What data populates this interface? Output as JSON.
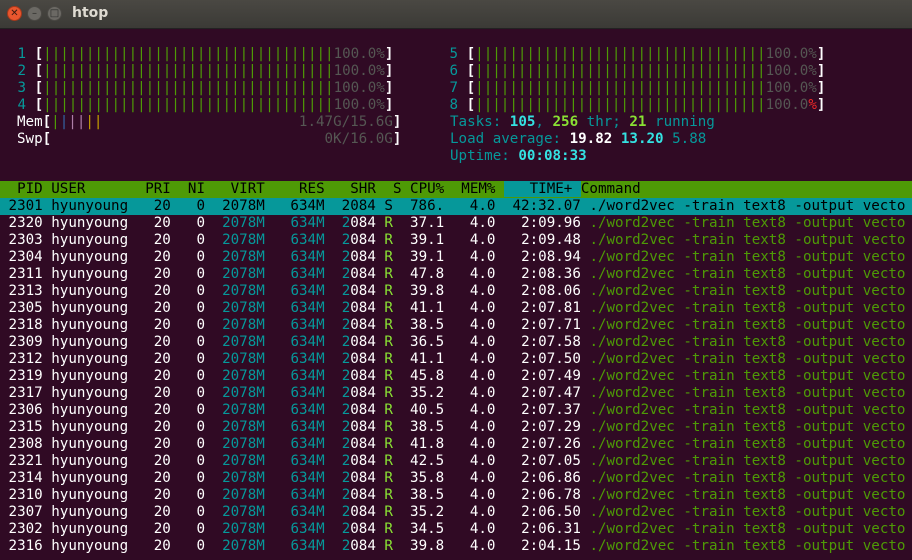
{
  "window": {
    "title": "htop"
  },
  "cpus_left": [
    {
      "id": "1",
      "bar": "||||||||||||||||||||||||||||||||||",
      "pct": "100.0%"
    },
    {
      "id": "2",
      "bar": "||||||||||||||||||||||||||||||||||",
      "pct": "100.0%"
    },
    {
      "id": "3",
      "bar": "||||||||||||||||||||||||||||||||||",
      "pct": "100.0%"
    },
    {
      "id": "4",
      "bar": "||||||||||||||||||||||||||||||||||",
      "pct": "100.0%"
    }
  ],
  "cpus_right": [
    {
      "id": "5",
      "bar": "||||||||||||||||||||||||||||||||||",
      "pct": "100.0%"
    },
    {
      "id": "6",
      "bar": "||||||||||||||||||||||||||||||||||",
      "pct": "100.0%"
    },
    {
      "id": "7",
      "bar": "||||||||||||||||||||||||||||||||||",
      "pct": "100.0%"
    },
    {
      "id": "8",
      "bar": "||||||||||||||||||||||||||||||||||",
      "pct": "100.0"
    }
  ],
  "mem": {
    "label": "Mem",
    "bars": [
      "|",
      "|",
      "|",
      "|",
      "|",
      "|"
    ],
    "value": "1.47G/15.6G"
  },
  "swp": {
    "label": "Swp",
    "value": "0K/16.0G"
  },
  "tasks": {
    "label": "Tasks: ",
    "count": "105",
    "thr": "256",
    "thr_label": " thr; ",
    "running": "21",
    "running_label": " running"
  },
  "load": {
    "label": "Load average: ",
    "l1": "19.82",
    "l5": "13.20",
    "l15": "5.88"
  },
  "uptime": {
    "label": "Uptime: ",
    "value": "00:08:33"
  },
  "columns": [
    "PID",
    "USER",
    "PRI",
    "NI",
    "VIRT",
    "RES",
    "SHR",
    "S",
    "CPU%",
    "MEM%",
    "TIME+",
    "Command"
  ],
  "processes": [
    {
      "pid": "2301",
      "user": "hyunyoung",
      "pri": "20",
      "ni": "0",
      "virt": "2078M",
      "res": "634M",
      "shr": "2084",
      "s": "S",
      "cpu": "786.",
      "mem": "4.0",
      "time": "42:32.07",
      "cmd": "./word2vec -train text8 -output vecto"
    },
    {
      "pid": "2320",
      "user": "hyunyoung",
      "pri": "20",
      "ni": "0",
      "virt": "2078M",
      "res": "634M",
      "shr": "2084",
      "s": "R",
      "cpu": "37.1",
      "mem": "4.0",
      "time": "2:09.96",
      "cmd": "./word2vec -train text8 -output vecto"
    },
    {
      "pid": "2303",
      "user": "hyunyoung",
      "pri": "20",
      "ni": "0",
      "virt": "2078M",
      "res": "634M",
      "shr": "2084",
      "s": "R",
      "cpu": "39.1",
      "mem": "4.0",
      "time": "2:09.48",
      "cmd": "./word2vec -train text8 -output vecto"
    },
    {
      "pid": "2304",
      "user": "hyunyoung",
      "pri": "20",
      "ni": "0",
      "virt": "2078M",
      "res": "634M",
      "shr": "2084",
      "s": "R",
      "cpu": "39.1",
      "mem": "4.0",
      "time": "2:08.94",
      "cmd": "./word2vec -train text8 -output vecto"
    },
    {
      "pid": "2311",
      "user": "hyunyoung",
      "pri": "20",
      "ni": "0",
      "virt": "2078M",
      "res": "634M",
      "shr": "2084",
      "s": "R",
      "cpu": "47.8",
      "mem": "4.0",
      "time": "2:08.36",
      "cmd": "./word2vec -train text8 -output vecto"
    },
    {
      "pid": "2313",
      "user": "hyunyoung",
      "pri": "20",
      "ni": "0",
      "virt": "2078M",
      "res": "634M",
      "shr": "2084",
      "s": "R",
      "cpu": "39.8",
      "mem": "4.0",
      "time": "2:08.06",
      "cmd": "./word2vec -train text8 -output vecto"
    },
    {
      "pid": "2305",
      "user": "hyunyoung",
      "pri": "20",
      "ni": "0",
      "virt": "2078M",
      "res": "634M",
      "shr": "2084",
      "s": "R",
      "cpu": "41.1",
      "mem": "4.0",
      "time": "2:07.81",
      "cmd": "./word2vec -train text8 -output vecto"
    },
    {
      "pid": "2318",
      "user": "hyunyoung",
      "pri": "20",
      "ni": "0",
      "virt": "2078M",
      "res": "634M",
      "shr": "2084",
      "s": "R",
      "cpu": "38.5",
      "mem": "4.0",
      "time": "2:07.71",
      "cmd": "./word2vec -train text8 -output vecto"
    },
    {
      "pid": "2309",
      "user": "hyunyoung",
      "pri": "20",
      "ni": "0",
      "virt": "2078M",
      "res": "634M",
      "shr": "2084",
      "s": "R",
      "cpu": "36.5",
      "mem": "4.0",
      "time": "2:07.58",
      "cmd": "./word2vec -train text8 -output vecto"
    },
    {
      "pid": "2312",
      "user": "hyunyoung",
      "pri": "20",
      "ni": "0",
      "virt": "2078M",
      "res": "634M",
      "shr": "2084",
      "s": "R",
      "cpu": "41.1",
      "mem": "4.0",
      "time": "2:07.50",
      "cmd": "./word2vec -train text8 -output vecto"
    },
    {
      "pid": "2319",
      "user": "hyunyoung",
      "pri": "20",
      "ni": "0",
      "virt": "2078M",
      "res": "634M",
      "shr": "2084",
      "s": "R",
      "cpu": "45.8",
      "mem": "4.0",
      "time": "2:07.49",
      "cmd": "./word2vec -train text8 -output vecto"
    },
    {
      "pid": "2317",
      "user": "hyunyoung",
      "pri": "20",
      "ni": "0",
      "virt": "2078M",
      "res": "634M",
      "shr": "2084",
      "s": "R",
      "cpu": "35.2",
      "mem": "4.0",
      "time": "2:07.47",
      "cmd": "./word2vec -train text8 -output vecto"
    },
    {
      "pid": "2306",
      "user": "hyunyoung",
      "pri": "20",
      "ni": "0",
      "virt": "2078M",
      "res": "634M",
      "shr": "2084",
      "s": "R",
      "cpu": "40.5",
      "mem": "4.0",
      "time": "2:07.37",
      "cmd": "./word2vec -train text8 -output vecto"
    },
    {
      "pid": "2315",
      "user": "hyunyoung",
      "pri": "20",
      "ni": "0",
      "virt": "2078M",
      "res": "634M",
      "shr": "2084",
      "s": "R",
      "cpu": "38.5",
      "mem": "4.0",
      "time": "2:07.29",
      "cmd": "./word2vec -train text8 -output vecto"
    },
    {
      "pid": "2308",
      "user": "hyunyoung",
      "pri": "20",
      "ni": "0",
      "virt": "2078M",
      "res": "634M",
      "shr": "2084",
      "s": "R",
      "cpu": "41.8",
      "mem": "4.0",
      "time": "2:07.26",
      "cmd": "./word2vec -train text8 -output vecto"
    },
    {
      "pid": "2321",
      "user": "hyunyoung",
      "pri": "20",
      "ni": "0",
      "virt": "2078M",
      "res": "634M",
      "shr": "2084",
      "s": "R",
      "cpu": "42.5",
      "mem": "4.0",
      "time": "2:07.05",
      "cmd": "./word2vec -train text8 -output vecto"
    },
    {
      "pid": "2314",
      "user": "hyunyoung",
      "pri": "20",
      "ni": "0",
      "virt": "2078M",
      "res": "634M",
      "shr": "2084",
      "s": "R",
      "cpu": "35.8",
      "mem": "4.0",
      "time": "2:06.86",
      "cmd": "./word2vec -train text8 -output vecto"
    },
    {
      "pid": "2310",
      "user": "hyunyoung",
      "pri": "20",
      "ni": "0",
      "virt": "2078M",
      "res": "634M",
      "shr": "2084",
      "s": "R",
      "cpu": "38.5",
      "mem": "4.0",
      "time": "2:06.78",
      "cmd": "./word2vec -train text8 -output vecto"
    },
    {
      "pid": "2307",
      "user": "hyunyoung",
      "pri": "20",
      "ni": "0",
      "virt": "2078M",
      "res": "634M",
      "shr": "2084",
      "s": "R",
      "cpu": "35.2",
      "mem": "4.0",
      "time": "2:06.50",
      "cmd": "./word2vec -train text8 -output vecto"
    },
    {
      "pid": "2302",
      "user": "hyunyoung",
      "pri": "20",
      "ni": "0",
      "virt": "2078M",
      "res": "634M",
      "shr": "2084",
      "s": "R",
      "cpu": "34.5",
      "mem": "4.0",
      "time": "2:06.31",
      "cmd": "./word2vec -train text8 -output vecto"
    },
    {
      "pid": "2316",
      "user": "hyunyoung",
      "pri": "20",
      "ni": "0",
      "virt": "2078M",
      "res": "634M",
      "shr": "2084",
      "s": "R",
      "cpu": "39.8",
      "mem": "4.0",
      "time": "2:04.15",
      "cmd": "./word2vec -train text8 -output vecto"
    }
  ],
  "colors": {
    "background": "#300a24",
    "header_bar": "#4e9a06",
    "selection": "#06989a",
    "bar_green": "#4e9a06"
  }
}
